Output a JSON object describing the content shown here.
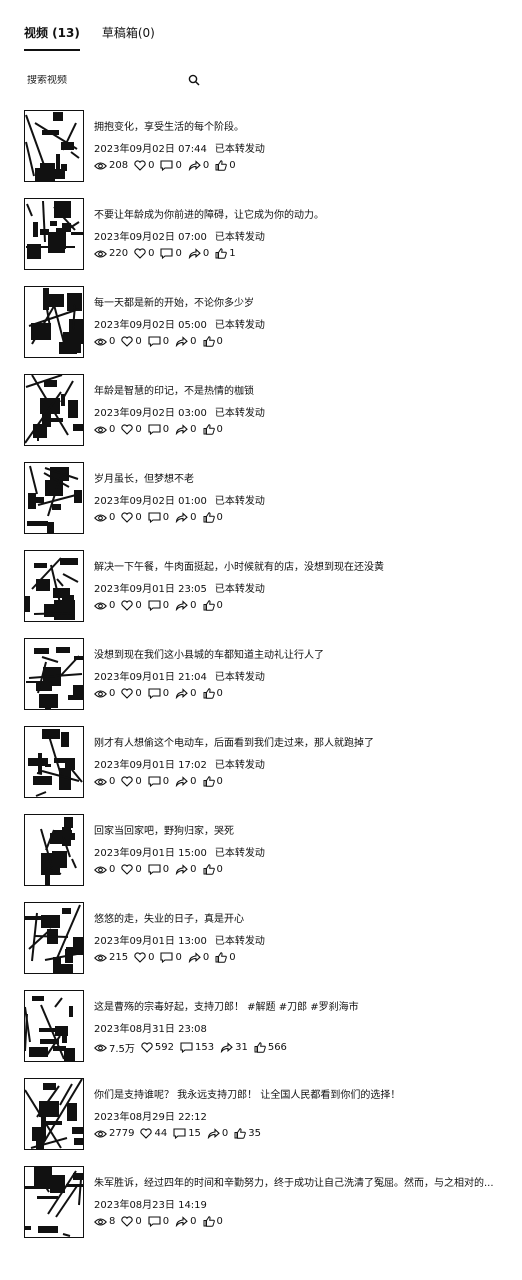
{
  "tabs": [
    {
      "label": "视频 (13)",
      "active": true
    },
    {
      "label": "草稿箱(0)",
      "active": false
    }
  ],
  "search": {
    "placeholder": "搜索视频"
  },
  "icons": {
    "search": "search-icon",
    "views": "eye-icon",
    "likes": "heart-icon",
    "comments": "comment-icon",
    "shares": "share-icon",
    "thumbs": "thumbs-up-icon"
  },
  "videos": [
    {
      "title": "拥抱变化，享受生活的每个阶段。",
      "time": "2023年09月02日 07:44",
      "status": "已本转发动",
      "views": "208",
      "likes": "0",
      "comments": "0",
      "shares": "0",
      "thumbs": "0"
    },
    {
      "title": "不要让年龄成为你前进的障碍，让它成为你的动力。",
      "time": "2023年09月02日 07:00",
      "status": "已本转发动",
      "views": "220",
      "likes": "0",
      "comments": "0",
      "shares": "0",
      "thumbs": "1"
    },
    {
      "title": "每一天都是新的开始，不论你多少岁",
      "time": "2023年09月02日 05:00",
      "status": "已本转发动",
      "views": "0",
      "likes": "0",
      "comments": "0",
      "shares": "0",
      "thumbs": "0"
    },
    {
      "title": "年龄是智慧的印记，不是热情的枷锁",
      "time": "2023年09月02日 03:00",
      "status": "已本转发动",
      "views": "0",
      "likes": "0",
      "comments": "0",
      "shares": "0",
      "thumbs": "0"
    },
    {
      "title": "岁月虽长，但梦想不老",
      "time": "2023年09月02日 01:00",
      "status": "已本转发动",
      "views": "0",
      "likes": "0",
      "comments": "0",
      "shares": "0",
      "thumbs": "0"
    },
    {
      "title": "解决一下午餐，牛肉面挺起，小时候就有的店，没想到现在还没黄",
      "time": "2023年09月01日 23:05",
      "status": "已本转发动",
      "views": "0",
      "likes": "0",
      "comments": "0",
      "shares": "0",
      "thumbs": "0"
    },
    {
      "title": "没想到现在我们这小县城的车都知道主动礼让行人了",
      "time": "2023年09月01日 21:04",
      "status": "已本转发动",
      "views": "0",
      "likes": "0",
      "comments": "0",
      "shares": "0",
      "thumbs": "0"
    },
    {
      "title": "刚才有人想偷这个电动车，后面看到我们走过来，那人就跑掉了",
      "time": "2023年09月01日 17:02",
      "status": "已本转发动",
      "views": "0",
      "likes": "0",
      "comments": "0",
      "shares": "0",
      "thumbs": "0"
    },
    {
      "title": "回家当回家吧，野狗归家，哭死",
      "time": "2023年09月01日 15:00",
      "status": "已本转发动",
      "views": "0",
      "likes": "0",
      "comments": "0",
      "shares": "0",
      "thumbs": "0"
    },
    {
      "title": "悠悠的走，失业的日子，真是开心",
      "time": "2023年09月01日 13:00",
      "status": "已本转发动",
      "views": "215",
      "likes": "0",
      "comments": "0",
      "shares": "0",
      "thumbs": "0"
    },
    {
      "title": "这是曹殇的宗毒好起，支持刀郎！ #解题 #刀郎 #罗刹海市",
      "time": "2023年08月31日 23:08",
      "status": "",
      "views": "7.5万",
      "likes": "592",
      "comments": "153",
      "shares": "31",
      "thumbs": "566"
    },
    {
      "title": "你们是支持谁呢？ 我永远支持刀郎！ 让全国人民都看到你们的选择！",
      "time": "2023年08月29日 22:12",
      "status": "",
      "views": "2779",
      "likes": "44",
      "comments": "15",
      "shares": "0",
      "thumbs": "35"
    },
    {
      "title": "朱军胜诉，经过四年的时间和辛勤努力，终于成功让自己洗清了冤屈。然而，与之相对的...",
      "time": "2023年08月23日 14:19",
      "status": "",
      "views": "8",
      "likes": "0",
      "comments": "0",
      "shares": "0",
      "thumbs": "0"
    }
  ]
}
